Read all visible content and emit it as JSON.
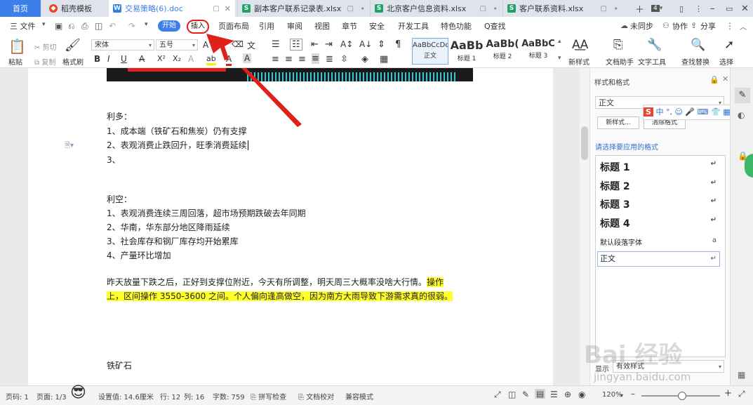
{
  "tabs": {
    "home": "首页",
    "daoke": "稻壳模板",
    "doc": "交易策略(6).doc",
    "sheet1": "副本客户联系记录表.xlsx",
    "sheet2": "北京客户信息资料.xlsx",
    "sheet3": "客户联系资料.xlsx",
    "count": "4"
  },
  "menu": {
    "file": "三 文件",
    "start": "开始",
    "insert": "插入",
    "items": [
      "页面布局",
      "引用",
      "审阅",
      "视图",
      "章节",
      "安全",
      "开发工具",
      "特色功能"
    ],
    "search": "Q查找",
    "sync": "未同步",
    "collab": "协作",
    "share": "分享"
  },
  "ribbon": {
    "paste": "粘贴",
    "cut": "剪切",
    "copy": "复制",
    "format_painter": "格式刷",
    "font_name": "宋体",
    "font_size": "五号",
    "styles": [
      {
        "sample": "AaBbCcDd",
        "name": "正文"
      },
      {
        "sample": "AaBb",
        "name": "标题 1"
      },
      {
        "sample": "AaBb(",
        "name": "标题 2"
      },
      {
        "sample": "AaBbC",
        "name": "标题 3"
      }
    ],
    "new_style": "新样式",
    "doc_helper": "文档助手",
    "text_tools": "文字工具",
    "find_replace": "查找替换",
    "select": "选择"
  },
  "document": {
    "bull_title": "利多：",
    "bull_items": [
      "1、成本端（铁矿石和焦炭）仍有支撑",
      "2、表观消费止跌回升，旺季消费延续",
      "3、"
    ],
    "bear_title": "利空：",
    "bear_items": [
      "1、表观消费连续三周回落，超市场预期跌破去年同期",
      "2、华南，华东部分地区降雨延续",
      "3、社会库存和钢厂库存均开始累库",
      "4、产量环比增加"
    ],
    "para_line1_plain": "昨天放量下跌之后，正好到支撑位附近，今天有所调整，明天周三大概率没啥大行情。",
    "para_line1_hl": "操作",
    "para_line2_hl": "上，区间操作 3550-3600 之间。个人偏向逢高做空，因为南方大雨导致下游需求真的很弱。",
    "section_title": "铁矿石"
  },
  "panel": {
    "title": "样式和格式",
    "current_style": "正文",
    "new_style_btn": "新样式...",
    "clear_format_btn": "清除格式",
    "apply_label": "请选择要应用的格式",
    "styles": [
      "标题 1",
      "标题 2",
      "标题 3",
      "标题 4",
      "默认段落字体",
      "正文"
    ],
    "show_label": "显示",
    "show_value": "有效样式"
  },
  "status": {
    "page_num": "页码: 1",
    "page_count": "页面: 1/3",
    "setting": "设置值: 14.6厘米",
    "row": "行: 12",
    "col": "列: 16",
    "word_count": "字数: 759",
    "spell": "拼写检查",
    "proof": "文档校对",
    "compat": "兼容模式",
    "zoom": "120%"
  },
  "watermark": {
    "line1": "Bai 经验",
    "line2": "jingyan.baidu.com"
  },
  "colors": {
    "accent": "#3d7fea",
    "annotation": "#e0201a",
    "highlight": "#ffff2a"
  }
}
